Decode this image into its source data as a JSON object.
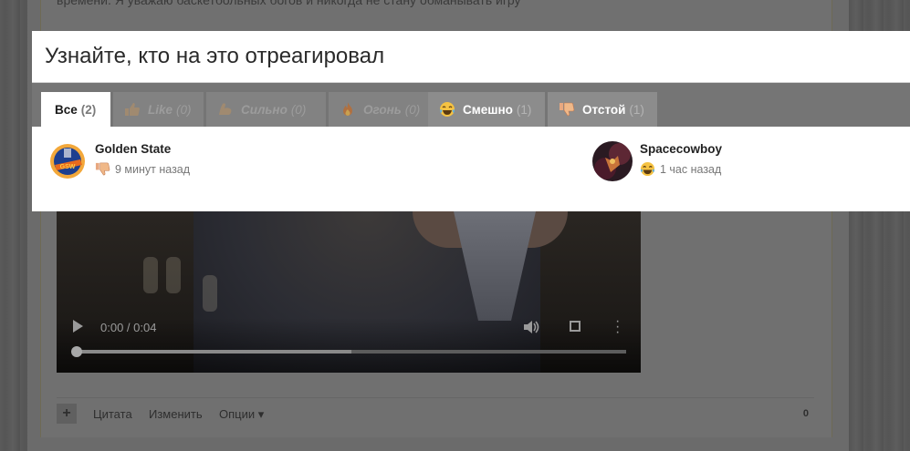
{
  "background": {
    "post_text": "времени. Я уважаю баскетбольных богов и никогда не стану обманывать игру\"",
    "video": {
      "time": "0:00 / 0:04",
      "progress": 0.0,
      "buffered": 0.5
    },
    "footer": {
      "plus": "+",
      "quote": "Цитата",
      "edit": "Изменить",
      "options": "Опции ▾",
      "count": "0"
    }
  },
  "modal": {
    "title": "Узнайте, кто на это отреагировал",
    "tabs": [
      {
        "label": "Все",
        "count": "(2)",
        "icon": ""
      },
      {
        "label": "Like",
        "count": "(0)",
        "icon": "thumbs-up-icon"
      },
      {
        "label": "Сильно",
        "count": "(0)",
        "icon": "flexed-biceps-icon"
      },
      {
        "label": "Огонь",
        "count": "(0)",
        "icon": "fire-icon"
      },
      {
        "label": "Смешно",
        "count": "(1)",
        "icon": "laughing-emoji-icon"
      },
      {
        "label": "Отстой",
        "count": "(1)",
        "icon": "thumbs-down-icon"
      }
    ],
    "reactions": [
      {
        "name": "Golden State",
        "time": "9 минут назад",
        "reaction_icon": "thumbs-down-icon"
      },
      {
        "name": "Spacecowboy",
        "time": "1 час назад",
        "reaction_icon": "laughing-emoji-icon"
      }
    ]
  },
  "colors": {
    "overlay": "#757575",
    "active_tab": "#ffffff",
    "tab": "#828282",
    "title": "#2a2a2a"
  }
}
